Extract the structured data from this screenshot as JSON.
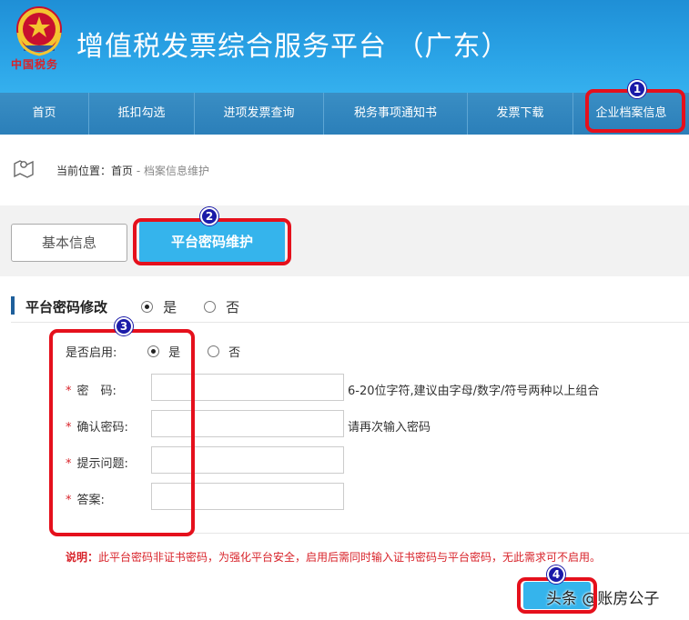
{
  "header": {
    "title": "增值税发票综合服务平台 （广东）",
    "brand": "中国税务"
  },
  "nav": {
    "items": [
      {
        "label": "首页"
      },
      {
        "label": "抵扣勾选"
      },
      {
        "label": "进项发票查询"
      },
      {
        "label": "税务事项通知书"
      },
      {
        "label": "发票下载"
      },
      {
        "label": "企业档案信息"
      }
    ]
  },
  "breadcrumb": {
    "prefix": "当前位置：",
    "home": "首页",
    "separator": " - ",
    "current": "档案信息维护"
  },
  "tabs": {
    "basic": "基本信息",
    "password": "平台密码维护"
  },
  "section": {
    "title": "平台密码修改",
    "yes": "是",
    "no": "否",
    "selected": "是"
  },
  "form": {
    "enable_label": "是否启用:",
    "enable_yes": "是",
    "enable_no": "否",
    "required_mark": "*",
    "password_label": "密　码:",
    "password_hint": "6-20位字符,建议由字母/数字/符号两种以上组合",
    "confirm_label": "确认密码:",
    "confirm_hint": "请再次输入密码",
    "question_label": "提示问题:",
    "answer_label": "答案:"
  },
  "note": {
    "prefix": "说明：",
    "text": "此平台密码非证书密码，为强化平台安全，启用后需同时输入证书密码与平台密码，无此需求可不启用。"
  },
  "watermark": "头条 @账房公子",
  "badges": [
    "1",
    "2",
    "3",
    "4"
  ],
  "colors": {
    "header": "#2aa3e6",
    "nav": "#2b7fb9",
    "accent": "#35b4ec",
    "highlight": "#e5101c",
    "badge": "#1a1aa8",
    "required": "#d8232a"
  }
}
